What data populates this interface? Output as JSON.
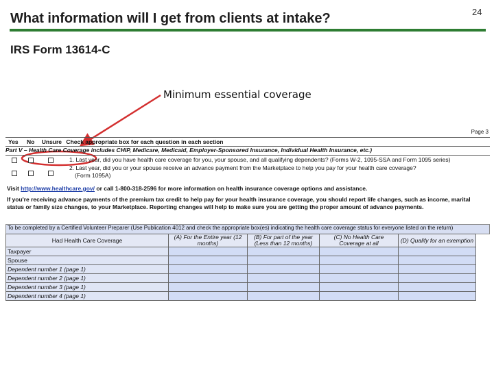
{
  "slide": {
    "title": "What information will I get from clients at intake?",
    "page_number": "24",
    "subtitle": "IRS Form 13614-C",
    "callout": "Minimum essential coverage"
  },
  "colors": {
    "accent_green": "#2e7d32",
    "callout_arrow": "#d32f2f",
    "table_blue": "#d2dcf5"
  },
  "form": {
    "page_label": "Page 3",
    "header": {
      "yes": "Yes",
      "no": "No",
      "unsure": "Unsure",
      "instruction": "Check appropriate box for each question in each section"
    },
    "part_heading": "Part V – Health Care Coverage includes CHIP, Medicare, Medicaid, Employer-Sponsored Insurance, Individual Health Insurance, etc.)",
    "questions": [
      "1. Last year, did you have health care coverage for you, your spouse, and all qualifying dependents? (Forms W-2, 1095-SSA and Form 1095 series)",
      "2. Last year, did you or your spouse receive an advance payment from the Marketplace to help you pay for your health care coverage?",
      "(Form 1095A)"
    ],
    "visit_prefix": "Visit",
    "visit_link": "http://www.healthcare.gov/",
    "visit_suffix": "or call 1-800-318-2596 for more information on health insurance coverage options and assistance.",
    "advance_note": "If you're receiving advance payments of the premium tax credit to help pay for your health insurance coverage, you should report life changes, such as income, marital status or family size changes, to your Marketplace. Reporting changes will help to make sure you are getting the proper amount of advance payments.",
    "table_banner": "To be completed by a Certified Volunteer Preparer (Use Publication 4012 and check the appropriate box(es) indicating the health care coverage status for everyone listed on the return)",
    "table": {
      "columns": [
        "Had Health Care Coverage",
        "(A) For the Entire year (12 months)",
        "(B) For part of the year (Less than 12 months)",
        "(C) No Health Care Coverage at all",
        "(D) Qualify for an exemption"
      ],
      "rows": [
        "Taxpayer",
        "Spouse",
        "Dependent number 1 (page 1)",
        "Dependent number 2 (page 1)",
        "Dependent number 3 (page 1)",
        "Dependent number 4 (page 1)"
      ]
    }
  }
}
